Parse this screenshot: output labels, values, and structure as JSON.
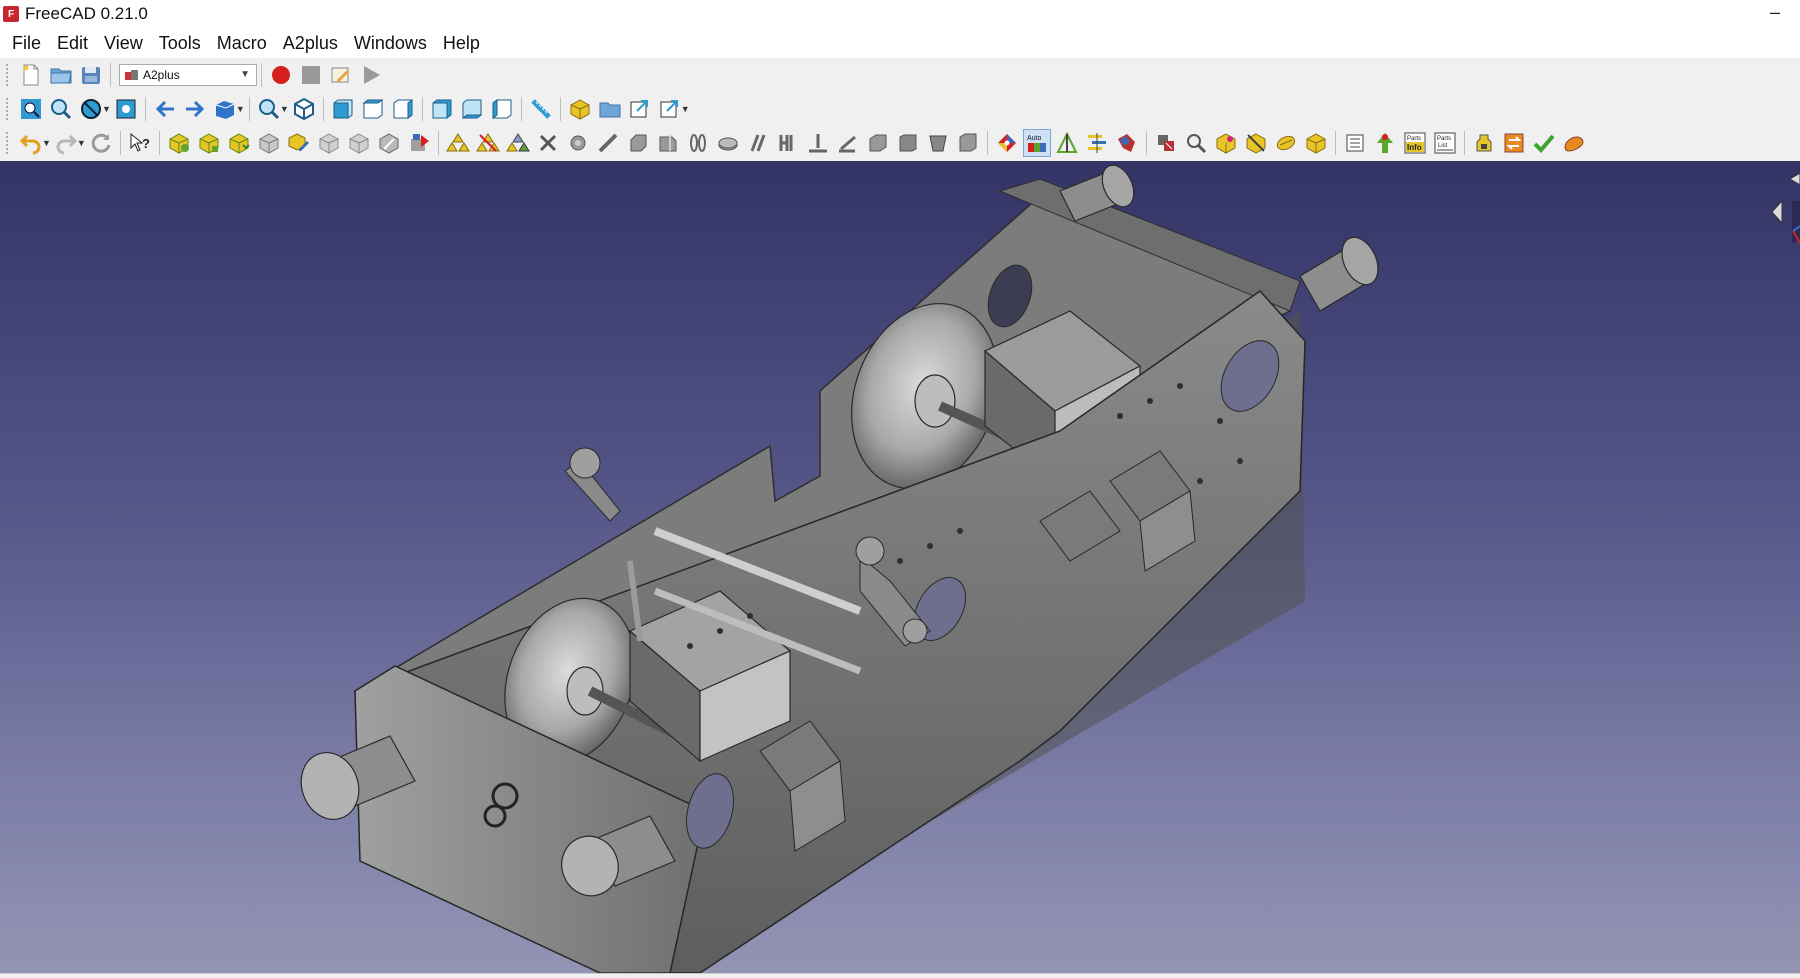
{
  "window": {
    "title": "FreeCAD 0.21.0",
    "minimize_glyph": "–"
  },
  "menu": {
    "items": [
      "File",
      "Edit",
      "View",
      "Tools",
      "Macro",
      "A2plus",
      "Windows",
      "Help"
    ]
  },
  "workbench_selector": {
    "selected": "A2plus"
  },
  "colors": {
    "viewport_top": "#333366",
    "viewport_bottom": "#9394b4",
    "model_gray": "#7a7a7a",
    "record_red": "#d62020",
    "arrow_blue": "#2f74c8",
    "cube_blue": "#2f9bd0",
    "assembly_yellow": "#e8c526"
  },
  "toolbar": {
    "row1_icons": [
      "new-document-icon",
      "open-document-icon",
      "save-document-icon",
      "macro-record-icon",
      "macro-stop-icon",
      "macro-edit-icon",
      "macro-execute-icon"
    ],
    "row2_icons": [
      "fit-all-icon",
      "fit-selection-icon",
      "draw-style-icon",
      "bounding-box-icon",
      "back-arrow-icon",
      "forward-arrow-icon",
      "sync-view-icon",
      "zoom-icon",
      "isometric-view-icon",
      "front-view-icon",
      "top-view-icon",
      "right-view-icon",
      "rear-view-icon",
      "bottom-view-icon",
      "left-view-icon",
      "measure-distance-icon",
      "create-part-icon",
      "create-group-icon",
      "create-link-icon",
      "link-actions-icon"
    ],
    "row3_icons": [
      "undo-icon",
      "redo-icon",
      "refresh-icon",
      "whats-this-icon",
      "add-part-icon",
      "add-part-from-file-icon",
      "update-imported-icon",
      "duplicate-part-icon",
      "edit-part-icon",
      "move-part-icon",
      "import-shape-icon",
      "convert-part-icon",
      "point-identity-icon",
      "point-on-line-icon",
      "point-on-plane-icon",
      "delete-constraints-icon",
      "sphere-constraint-icon",
      "circular-edge-icon",
      "axial-alignment-icon",
      "axis-parallel-icon",
      "axis-plane-parallel-icon",
      "axis-plane-angle-icon",
      "axis-plane-normal-icon",
      "planes-parallel-icon",
      "plane-coincident-icon",
      "angled-planes-icon",
      "center-of-mass-icon",
      "solve-constraints-icon",
      "auto-solve-icon",
      "flip-direction-icon",
      "constraint-list-icon",
      "constraint-editor-icon",
      "delete-item-icon",
      "search-icon",
      "show-dependencies-icon",
      "toggle-transparency-icon",
      "show-hidden-icon",
      "isolate-icon",
      "parts-tree-icon",
      "add-part-tree-icon",
      "parts-info-icon",
      "parts-list-icon",
      "clean-up-icon",
      "migrate-icon",
      "check-mark-icon",
      "edit-joint-icon"
    ],
    "auto_label": "Auto",
    "info_label": "Info",
    "parts_label": "Parts",
    "list_label": "List"
  }
}
